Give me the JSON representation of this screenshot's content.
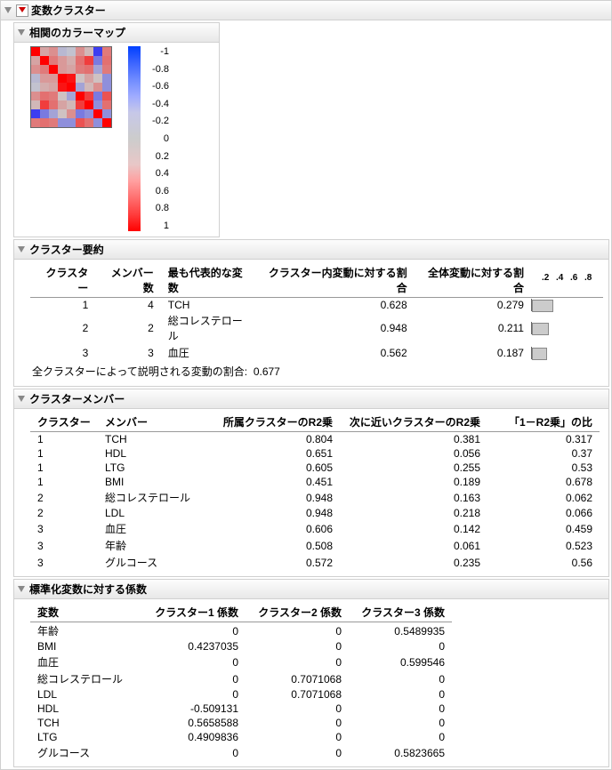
{
  "title": "変数クラスター",
  "colormap": {
    "title": "相関のカラーマップ",
    "ticks": [
      "-1",
      "-0.8",
      "-0.6",
      "-0.4",
      "-0.2",
      "0",
      "0.2",
      "0.4",
      "0.6",
      "0.8",
      "1"
    ]
  },
  "summary": {
    "title": "クラスター要約",
    "headers": {
      "cluster": "クラスター",
      "members": "メンバー数",
      "repvar": "最も代表的な変数",
      "within": "クラスター内変動に対する割合",
      "total": "全体変動に対する割合"
    },
    "axis": [
      ".2",
      ".4",
      ".6",
      ".8"
    ],
    "rows": [
      {
        "cluster": "1",
        "members": "4",
        "repvar": "TCH",
        "within": "0.628",
        "total": "0.279",
        "bar": 0.279
      },
      {
        "cluster": "2",
        "members": "2",
        "repvar": "総コレステロール",
        "within": "0.948",
        "total": "0.211",
        "bar": 0.211
      },
      {
        "cluster": "3",
        "members": "3",
        "repvar": "血圧",
        "within": "0.562",
        "total": "0.187",
        "bar": 0.187
      }
    ],
    "note_label": "全クラスターによって説明される変動の割合:",
    "note_value": "0.677"
  },
  "members": {
    "title": "クラスターメンバー",
    "headers": {
      "cluster": "クラスター",
      "member": "メンバー",
      "own": "所属クラスターのR2乗",
      "next": "次に近いクラスターのR2乗",
      "ratio": "「1－R2乗」の比"
    },
    "rows": [
      {
        "c": "1",
        "m": "TCH",
        "own": "0.804",
        "next": "0.381",
        "r": "0.317"
      },
      {
        "c": "1",
        "m": "HDL",
        "own": "0.651",
        "next": "0.056",
        "r": "0.37"
      },
      {
        "c": "1",
        "m": "LTG",
        "own": "0.605",
        "next": "0.255",
        "r": "0.53"
      },
      {
        "c": "1",
        "m": "BMI",
        "own": "0.451",
        "next": "0.189",
        "r": "0.678"
      },
      {
        "c": "2",
        "m": "総コレステロール",
        "own": "0.948",
        "next": "0.163",
        "r": "0.062"
      },
      {
        "c": "2",
        "m": "LDL",
        "own": "0.948",
        "next": "0.218",
        "r": "0.066"
      },
      {
        "c": "3",
        "m": "血圧",
        "own": "0.606",
        "next": "0.142",
        "r": "0.459"
      },
      {
        "c": "3",
        "m": "年齢",
        "own": "0.508",
        "next": "0.061",
        "r": "0.523"
      },
      {
        "c": "3",
        "m": "グルコース",
        "own": "0.572",
        "next": "0.235",
        "r": "0.56"
      }
    ]
  },
  "coef": {
    "title": "標準化変数に対する係数",
    "headers": {
      "var": "変数",
      "c1": "クラスター1 係数",
      "c2": "クラスター2 係数",
      "c3": "クラスター3 係数"
    },
    "rows": [
      {
        "v": "年齢",
        "c1": "0",
        "c2": "0",
        "c3": "0.5489935"
      },
      {
        "v": "BMI",
        "c1": "0.4237035",
        "c2": "0",
        "c3": "0"
      },
      {
        "v": "血圧",
        "c1": "0",
        "c2": "0",
        "c3": "0.599546"
      },
      {
        "v": "総コレステロール",
        "c1": "0",
        "c2": "0.7071068",
        "c3": "0"
      },
      {
        "v": "LDL",
        "c1": "0",
        "c2": "0.7071068",
        "c3": "0"
      },
      {
        "v": "HDL",
        "c1": "-0.509131",
        "c2": "0",
        "c3": "0"
      },
      {
        "v": "TCH",
        "c1": "0.5658588",
        "c2": "0",
        "c3": "0"
      },
      {
        "v": "LTG",
        "c1": "0.4909836",
        "c2": "0",
        "c3": "0"
      },
      {
        "v": "グルコース",
        "c1": "0",
        "c2": "0",
        "c3": "0.5823665"
      }
    ]
  },
  "chart_data": {
    "type": "heatmap",
    "title": "相関のカラーマップ",
    "colorscale_range": [
      -1,
      1
    ],
    "n": 9,
    "note": "9×9 correlation matrix; diagonal = 1 (deep red). Off-diagonal values approximate from color: reds ≈ positive correlation, blues ≈ negative, gray ≈ ~0.",
    "matrix_approx": [
      [
        1.0,
        0.2,
        0.3,
        -0.1,
        -0.05,
        0.3,
        0.1,
        -0.7,
        0.4
      ],
      [
        0.2,
        1.0,
        0.4,
        0.25,
        0.15,
        0.45,
        0.7,
        -0.4,
        0.45
      ],
      [
        0.3,
        0.4,
        1.0,
        0.25,
        0.2,
        0.4,
        0.45,
        -0.2,
        0.4
      ],
      [
        -0.1,
        0.25,
        0.25,
        1.0,
        0.9,
        0.05,
        0.2,
        0.05,
        -0.3
      ],
      [
        -0.05,
        0.15,
        0.2,
        0.9,
        1.0,
        -0.2,
        0.1,
        0.3,
        -0.3
      ],
      [
        0.3,
        0.45,
        0.4,
        0.05,
        -0.2,
        1.0,
        0.7,
        -0.4,
        0.6
      ],
      [
        0.1,
        0.7,
        0.45,
        0.2,
        0.1,
        0.7,
        1.0,
        -0.3,
        0.45
      ],
      [
        -0.7,
        -0.4,
        -0.2,
        0.05,
        0.3,
        -0.4,
        -0.3,
        1.0,
        -0.3
      ],
      [
        0.4,
        0.45,
        0.4,
        -0.3,
        -0.3,
        0.6,
        0.45,
        -0.3,
        1.0
      ]
    ]
  }
}
